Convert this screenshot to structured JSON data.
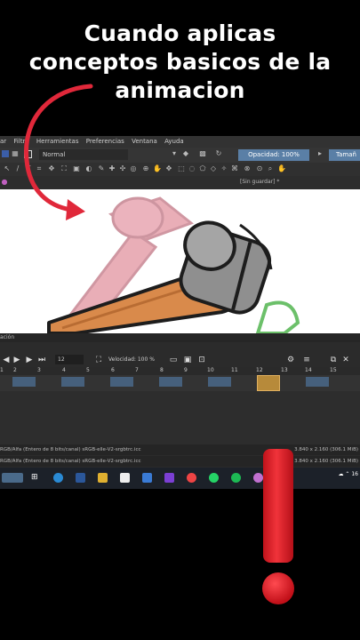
{
  "caption": {
    "line1": "Cuando aplicas",
    "line2": "conceptos basicos de la",
    "line3": "animacion"
  },
  "menu": {
    "items": [
      "ar",
      "Filtro",
      "Herramientas",
      "Preferencias",
      "Ventana",
      "Ayuda"
    ]
  },
  "toolbar": {
    "blend_mode": "Normal",
    "opacity_label": "Opacidad: 100%",
    "size_label": "Tamañ",
    "doc_status": "[Sin guardar] *"
  },
  "animation": {
    "panel_title": "ación",
    "current_frame": "12",
    "speed_label": "Velocidad: 100 %",
    "ruler": [
      "1",
      "2",
      "3",
      "4",
      "5",
      "6",
      "7",
      "8",
      "9",
      "10",
      "11",
      "12",
      "13",
      "14",
      "15"
    ]
  },
  "status": {
    "line1_left": "RGB/Alfa (Entero de 8 bits/canal)  sRGB-elle-V2-srgbtrc.icc",
    "line1_right": "3.840 x 2.160 (306.1 MiB)",
    "line2_left": "RGB/Alfa (Entero de 8 bits/canal)  sRGB-elle-V2-srgbtrc.icc",
    "line2_right": "3.840 x 2.160 (306.1 MiB)"
  },
  "taskbar": {
    "tray_text": "16"
  },
  "colors": {
    "arrow": "#e0283a",
    "warning": "#e8222b",
    "keyframe": "#46607c",
    "keyframe_selected": "#b78a3a",
    "accent": "#5a7fa6"
  }
}
